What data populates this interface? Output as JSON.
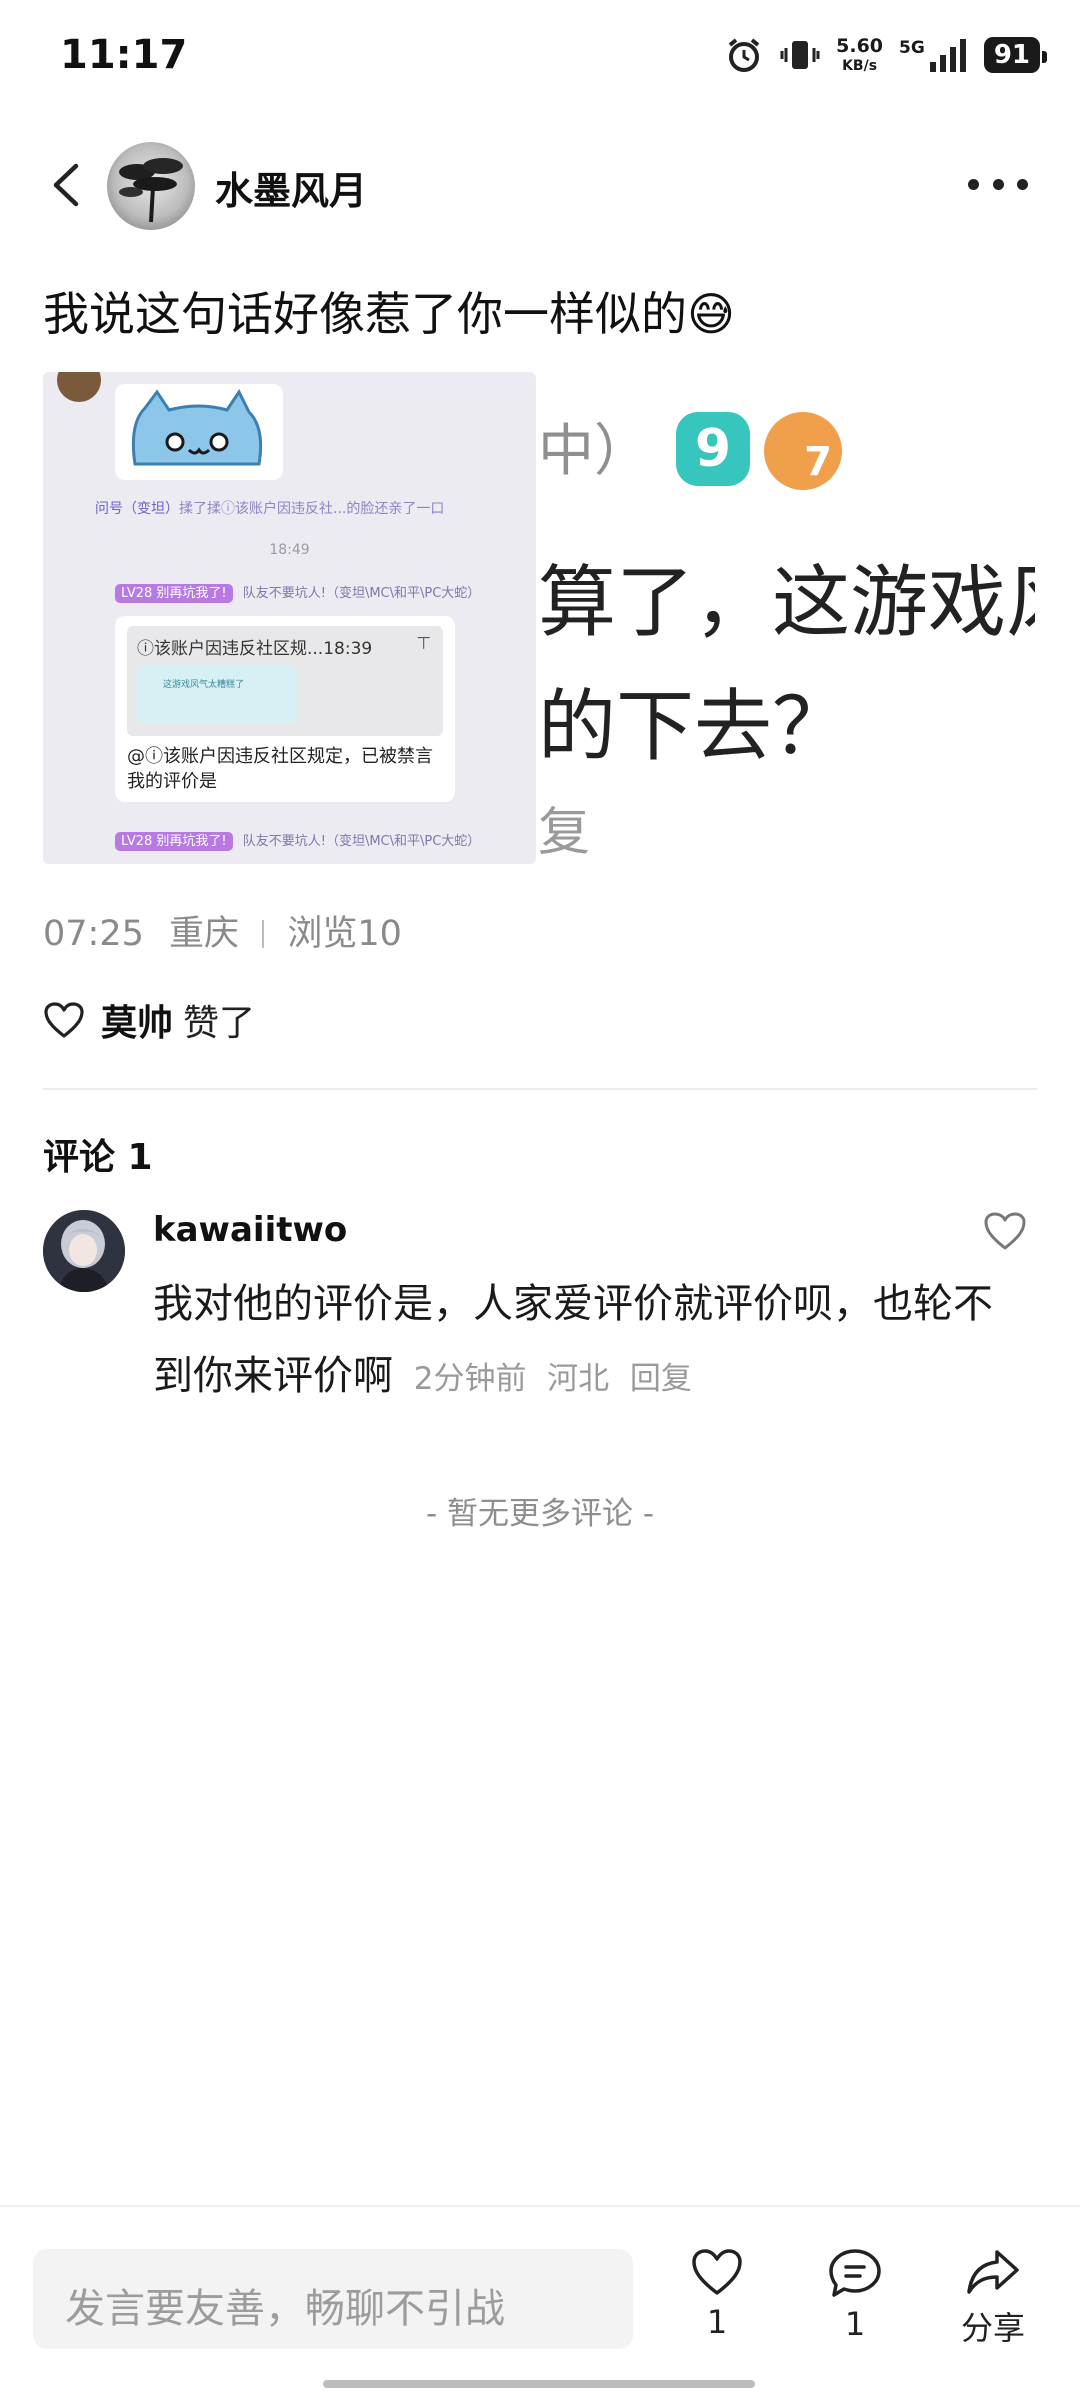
{
  "status_bar": {
    "time": "11:17",
    "net_speed": "5.60",
    "net_unit": "KB/s",
    "network": "5G",
    "battery": "91"
  },
  "header": {
    "username": "水墨风月"
  },
  "post": {
    "text": "我说这句话好像惹了你一样似的😅",
    "image": {
      "chat_name_line": "问号（变坦）",
      "chat_action_text": "揉了揉ⓘ该账户因违反社...的脸还亲了一口",
      "chat_time": "18:49",
      "level_badge": "LV28 别再坑我了!",
      "level_badge_text": "队友不要坑人!（变坦\\MC\\和平\\PC大蛇）",
      "quote_title": "ⓘ该账户因违反社区规...18:39",
      "quote_body": "@ⓘ该账户因违反社区规定，已被禁言 我的评价是",
      "quote_mini_text": "这游戏风气太糟糕了",
      "right_top": "中）",
      "right_badge_1": "9",
      "right_badge_2": "7",
      "right_line_1": "算了，这游戏风",
      "right_line_2": "的下去？",
      "right_line_3": "复"
    },
    "time": "07:25",
    "location": "重庆",
    "views": "浏览10",
    "liker": "莫帅",
    "liked_suffix": "赞了"
  },
  "comments": {
    "title": "评论 1",
    "items": [
      {
        "user": "kawaiitwo",
        "text": "我对他的评价是，人家爱评价就评价呗，也轮不到你来评价啊",
        "time_ago": "2分钟前",
        "location": "河北",
        "reply_label": "回复"
      }
    ],
    "no_more": "- 暂无更多评论 -"
  },
  "bottom_bar": {
    "input_placeholder": "发言要友善，畅聊不引战",
    "like_count": "1",
    "comment_count": "1",
    "share_label": "分享"
  }
}
